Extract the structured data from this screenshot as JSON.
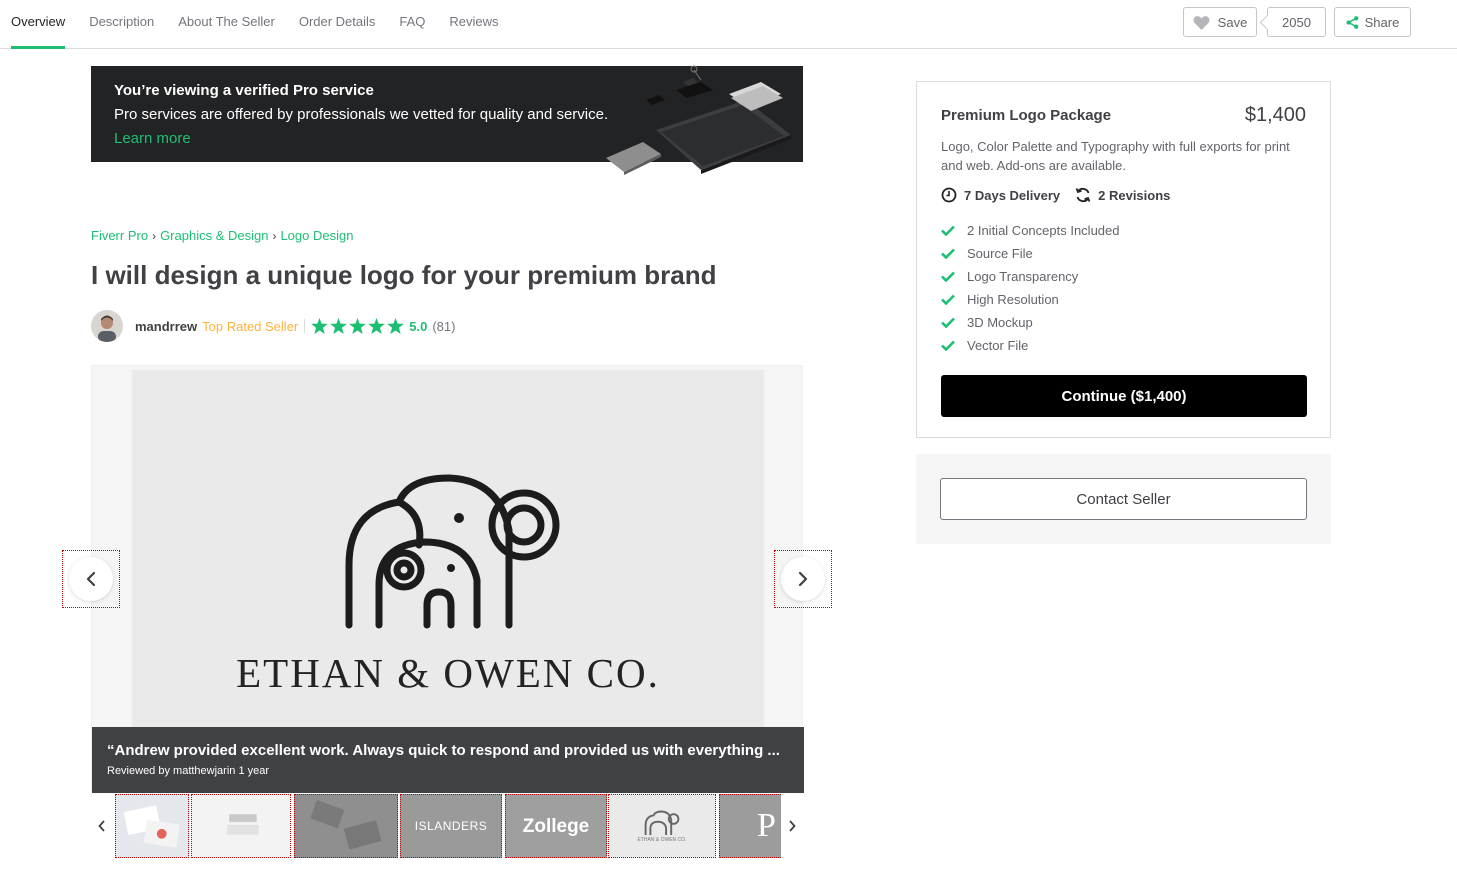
{
  "nav": {
    "tabs": [
      "Overview",
      "Description",
      "About The Seller",
      "Order Details",
      "FAQ",
      "Reviews"
    ],
    "active_tab": "Overview",
    "save_label": "Save",
    "save_count": "2050",
    "share_label": "Share"
  },
  "pro_banner": {
    "title": "You’re viewing a verified Pro service",
    "text": "Pro services are offered by professionals we vetted for quality and service.",
    "link": "Learn more"
  },
  "breadcrumb": [
    "Fiverr Pro",
    "Graphics & Design",
    "Logo Design"
  ],
  "gig_title": "I will design a unique logo for your premium brand",
  "seller": {
    "name": "mandrrew",
    "level": "Top Rated Seller",
    "rating": "5.0",
    "rating_count": "(81)",
    "stars": 5
  },
  "gallery": {
    "slide_text": "ETHAN & OWEN CO.",
    "review_quote": "“Andrew provided excellent work. Always quick to respond and provided us with everything ...",
    "review_by": "Reviewed by matthewjarin 1 year",
    "thumbnails": [
      "",
      "",
      "",
      "ISLANDERS",
      "Zollege",
      "ETHAN & OWEN CO.",
      "P"
    ]
  },
  "package": {
    "name": "Premium Logo Package",
    "price": "$1,400",
    "description": "Logo, Color Palette and Typography with full exports for print and web. Add-ons are available.",
    "delivery": "7 Days Delivery",
    "revisions": "2 Revisions",
    "features": [
      "2 Initial Concepts Included",
      "Source File",
      "Logo Transparency",
      "High Resolution",
      "3D Mockup",
      "Vector File"
    ],
    "continue_label": "Continue ($1,400)"
  },
  "contact_label": "Contact Seller",
  "colors": {
    "accent": "#1dbf73",
    "top_rated": "#ffb33e",
    "dark": "#222325",
    "text": "#404145"
  }
}
